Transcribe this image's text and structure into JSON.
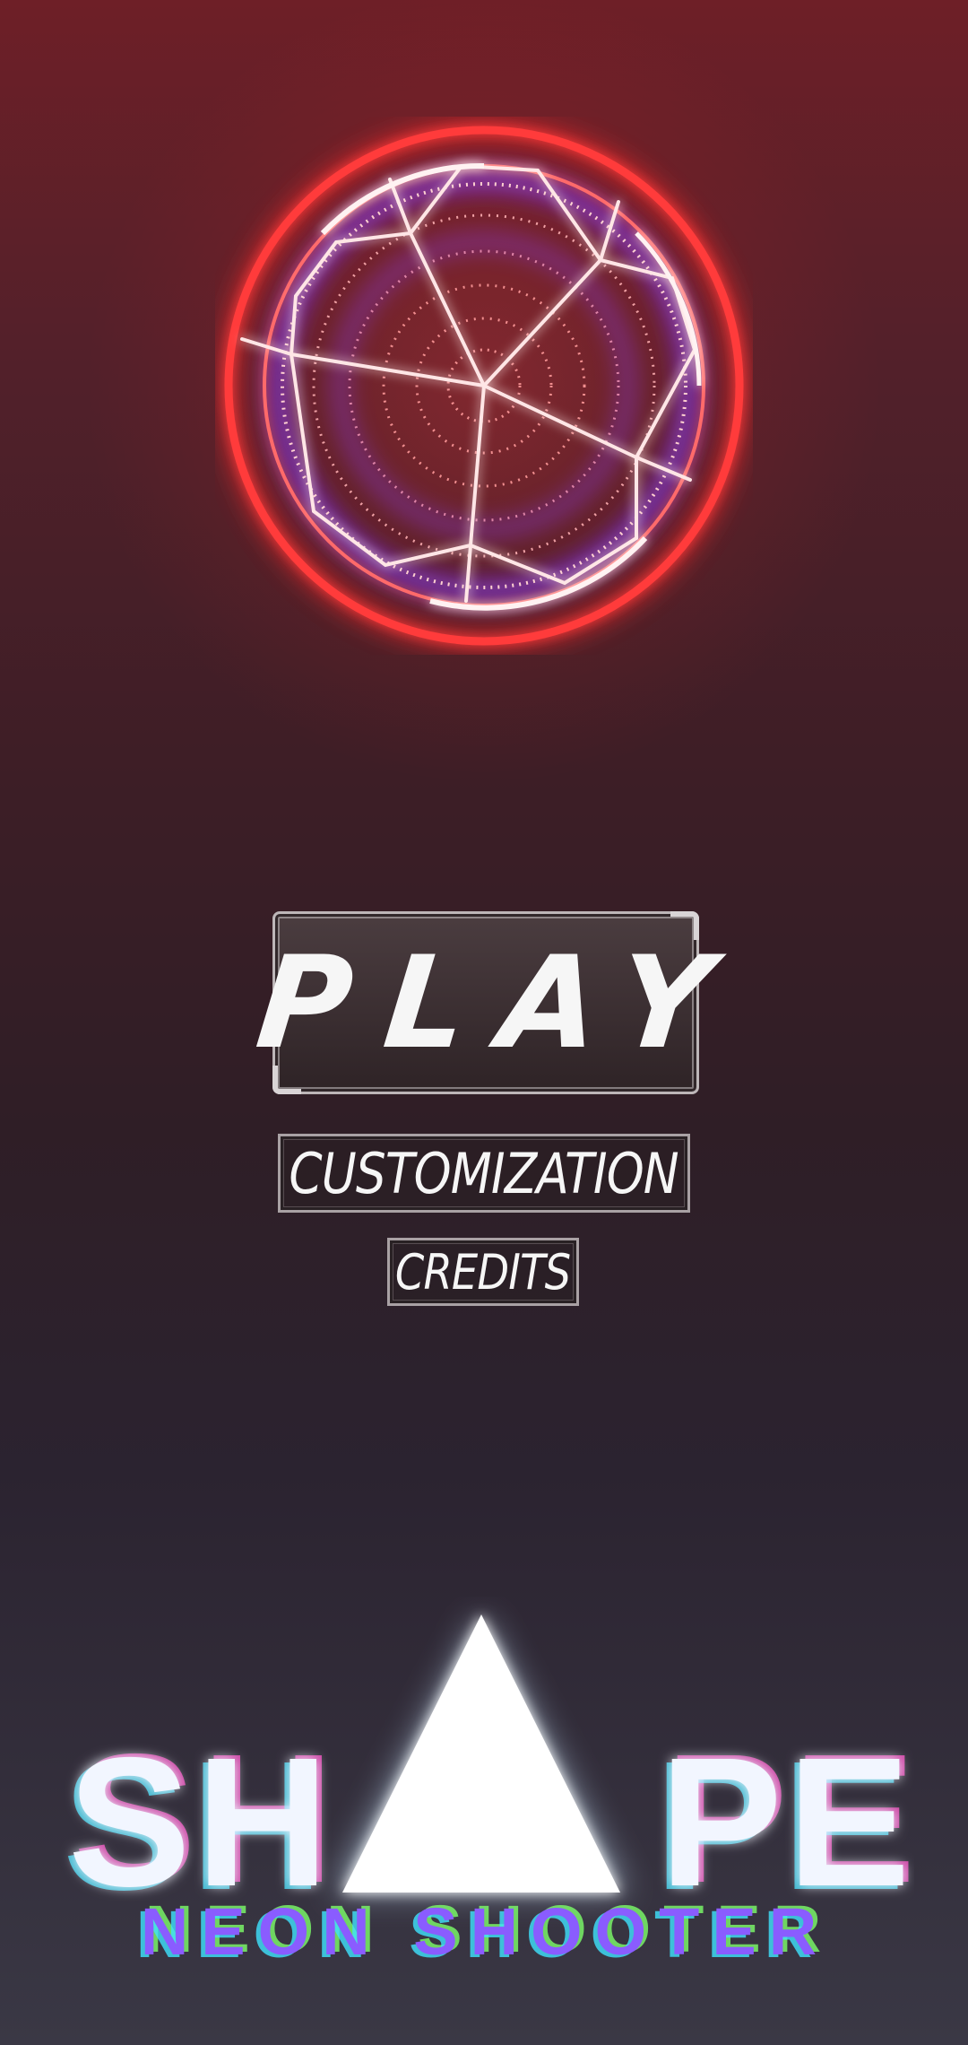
{
  "menu": {
    "play_label": "PLAY",
    "customization_label": "CUSTOMIZATION",
    "credits_label": "CREDITS"
  },
  "logo": {
    "title_left": "SH",
    "title_right": "PE",
    "subtitle": "NEON SHOOTER"
  },
  "colors": {
    "orb_red": "#ff3b3b",
    "orb_purple": "#8a3cff",
    "button_border": "#bdb6b8",
    "logo_cyan": "#3fe3ff",
    "logo_magenta": "#ff4fc8",
    "logo_green": "#7dff6a"
  },
  "icons": {
    "orb": "neon-sphere-icon",
    "logo_mark": "triangle-icon"
  }
}
